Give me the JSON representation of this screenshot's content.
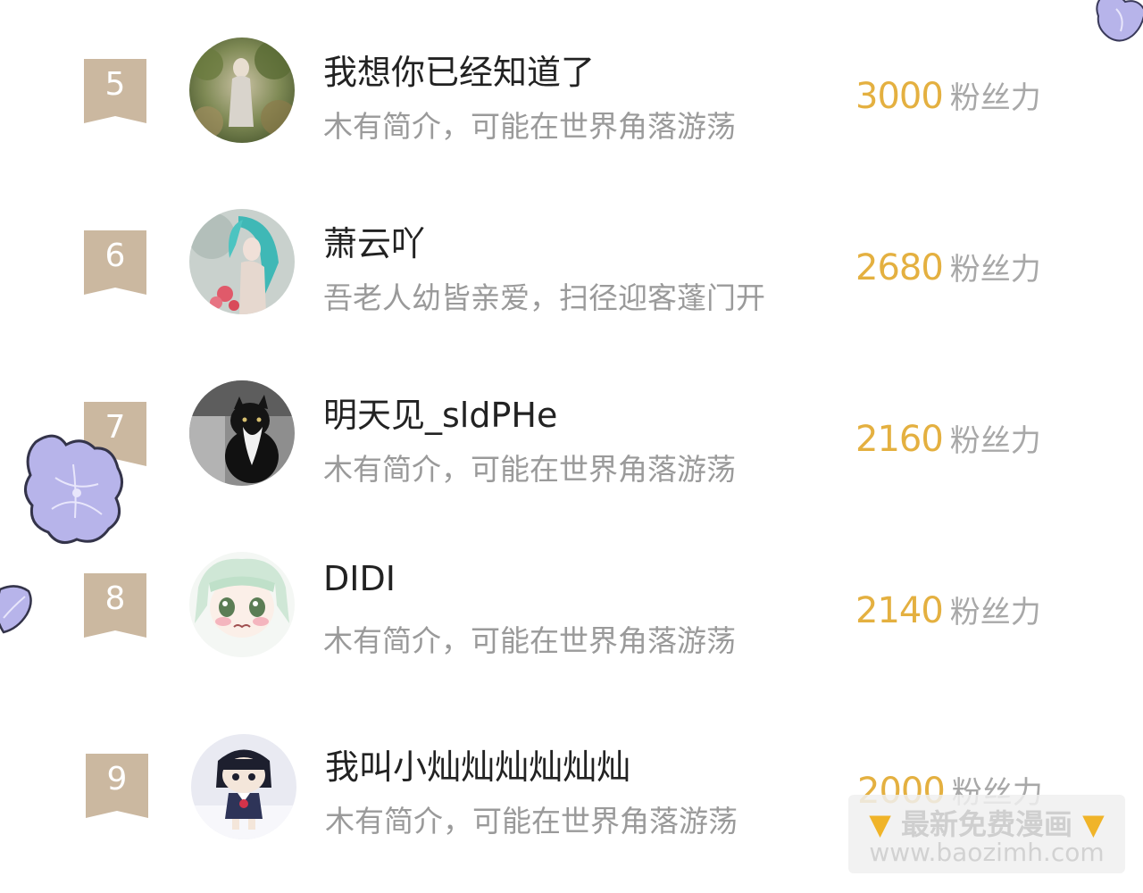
{
  "ranking": [
    {
      "rank": "5",
      "name": "我想你已经知道了",
      "bio": "木有简介，可能在世界角落游荡",
      "fans": "3000",
      "fans_label": "粉丝力",
      "avatar": "forest-girl-avatar"
    },
    {
      "rank": "6",
      "name": "萧云吖",
      "bio": "吾老人幼皆亲爱，扫径迎客蓬门开",
      "fans": "2680",
      "fans_label": "粉丝力",
      "avatar": "teal-hair-girl-avatar"
    },
    {
      "rank": "7",
      "name": "明天见_sldPHe",
      "bio": "木有简介，可能在世界角落游荡",
      "fans": "2160",
      "fans_label": "粉丝力",
      "avatar": "black-white-cat-avatar"
    },
    {
      "rank": "8",
      "name": "DIDI",
      "bio": "木有简介，可能在世界角落游荡",
      "fans": "2140",
      "fans_label": "粉丝力",
      "avatar": "anime-green-hair-avatar"
    },
    {
      "rank": "9",
      "name": "我叫小灿灿灿灿灿灿",
      "bio": "木有简介，可能在世界角落游荡",
      "fans": "2000",
      "fans_label": "粉丝力",
      "avatar": "doll-figure-avatar"
    }
  ],
  "watermark": {
    "line1": "最新免费漫画",
    "line2": "www.baozimh.com",
    "icon": "pointing-down-hand-icon"
  },
  "colors": {
    "badge": "#cbb8a0",
    "fans_number": "#e4b040",
    "name": "#222222",
    "bio": "#9a9a9a",
    "flower": "#b7b4ea"
  }
}
